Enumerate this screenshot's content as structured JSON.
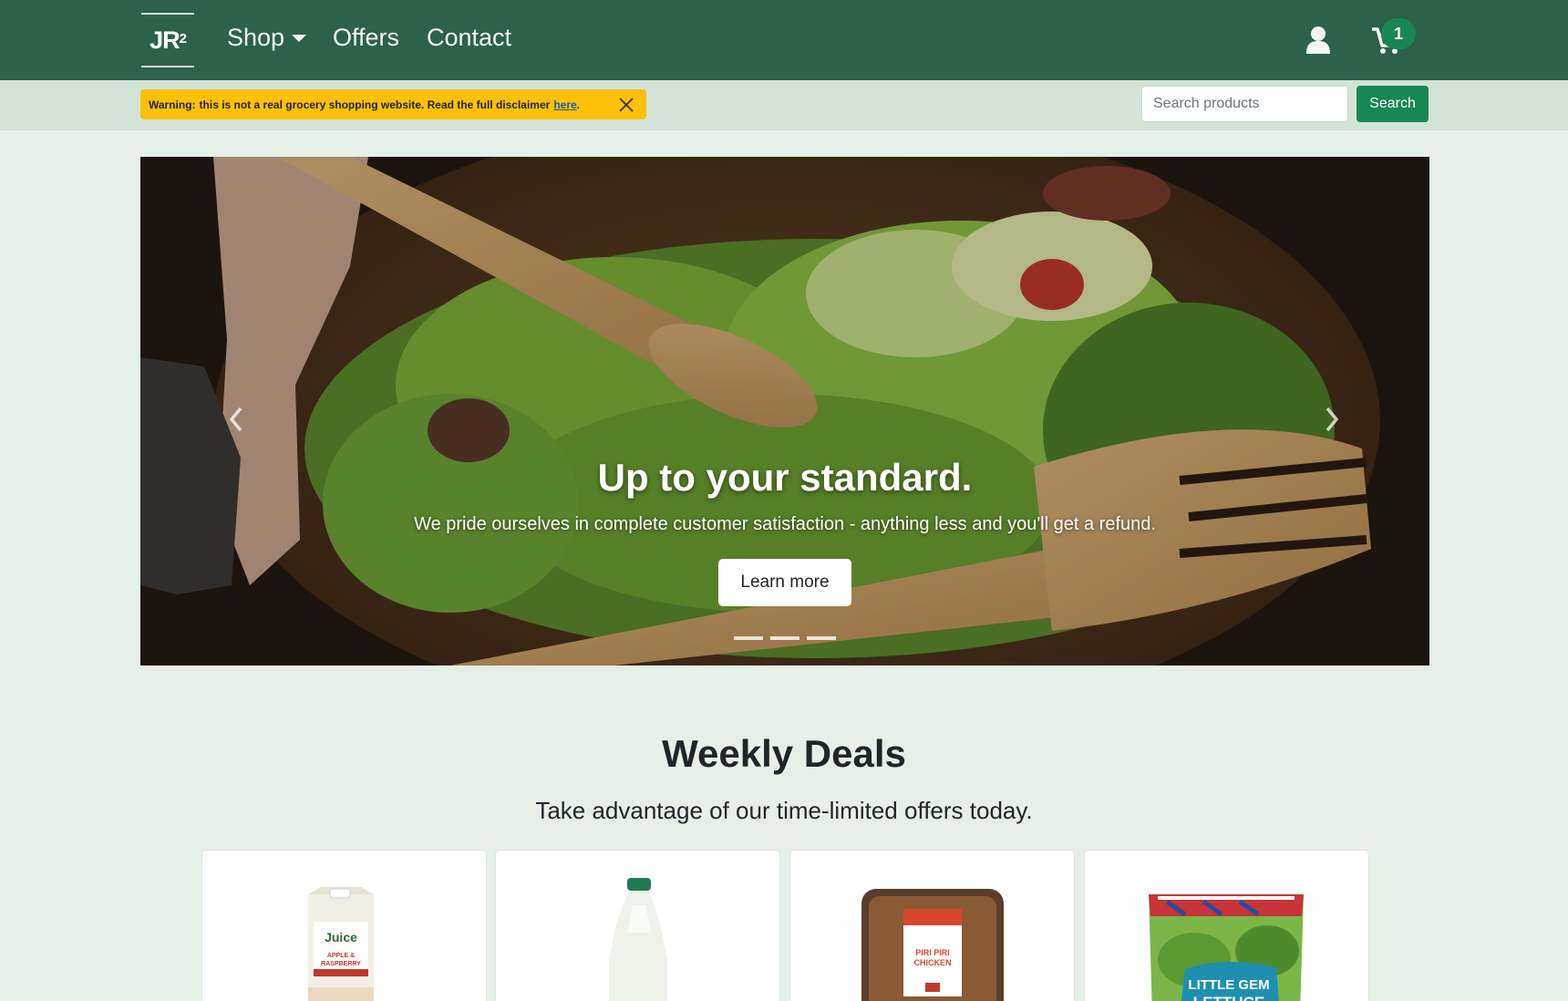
{
  "brand": {
    "logo_text": "JR",
    "logo_sup": "2"
  },
  "nav": {
    "shop": "Shop",
    "offers": "Offers",
    "contact": "Contact",
    "cart_count": "1",
    "icons": [
      "user-icon",
      "cart-icon",
      "chevron-down-icon"
    ]
  },
  "warning": {
    "label": "Warning:",
    "text": "this is not a real grocery shopping website. Read the full disclaimer",
    "link": "here",
    "end": ".",
    "bg_color": "#ffc107"
  },
  "search": {
    "placeholder": "Search products",
    "button": "Search"
  },
  "hero": {
    "title": "Up to your standard.",
    "subtitle": "We pride ourselves in complete customer satisfaction - anything less and you'll get a refund.",
    "button": "Learn more",
    "slides": 3
  },
  "deals": {
    "title": "Weekly Deals",
    "subtitle": "Take advantage of our time-limited offers today.",
    "products": [
      {
        "label_line1": "Juice",
        "label_line2": "APPLE &",
        "label_line3": "RASPBERRY",
        "icon": "juice-carton-image"
      },
      {
        "icon": "milk-bottle-image"
      },
      {
        "label_line1": "PIRI PIRI",
        "label_line2": "CHICKEN",
        "icon": "chicken-tray-image"
      },
      {
        "label_line1": "LITTLE GEM",
        "label_line2": "LETTUCE",
        "icon": "lettuce-bag-image"
      }
    ]
  },
  "colors": {
    "navbar": "#2b6249",
    "accent": "#198754",
    "page_bg": "#e6f0e8",
    "subbar": "#d3e3d8"
  }
}
